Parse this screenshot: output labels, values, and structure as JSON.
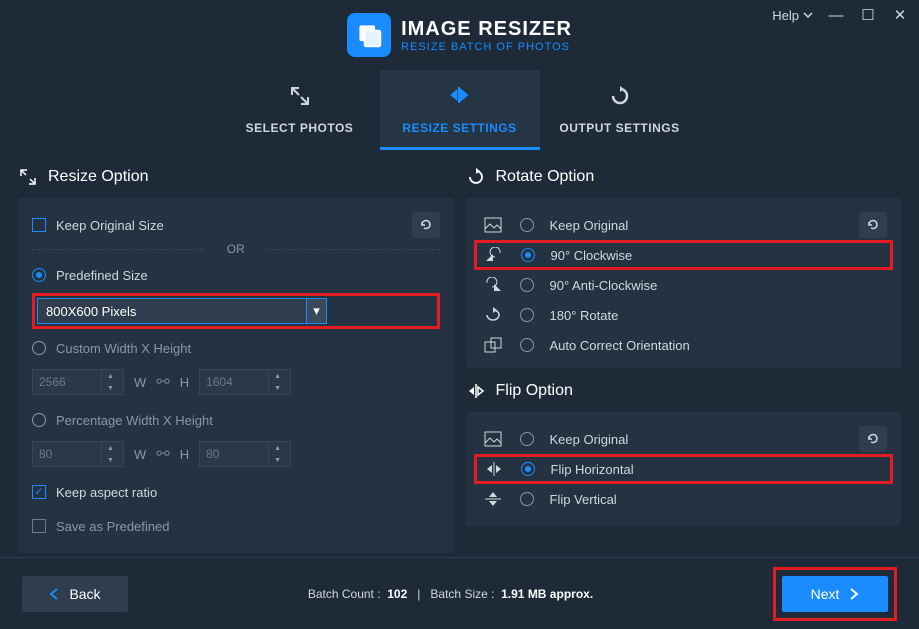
{
  "app": {
    "title": "IMAGE RESIZER",
    "subtitle": "RESIZE BATCH OF PHOTOS"
  },
  "window": {
    "help": "Help"
  },
  "tabs": {
    "select": "SELECT PHOTOS",
    "resize": "RESIZE SETTINGS",
    "output": "OUTPUT SETTINGS"
  },
  "resize": {
    "header": "Resize Option",
    "keep_original": "Keep Original Size",
    "or": "OR",
    "predefined": "Predefined Size",
    "predefined_value": "800X600 Pixels",
    "custom": "Custom Width X Height",
    "custom_w": "2566",
    "custom_h": "1604",
    "percent": "Percentage Width X Height",
    "percent_w": "80",
    "percent_h": "80",
    "w": "W",
    "h": "H",
    "keep_aspect": "Keep aspect ratio",
    "save_predef": "Save as Predefined"
  },
  "rotate": {
    "header": "Rotate Option",
    "keep": "Keep Original",
    "cw": "90° Clockwise",
    "acw": "90° Anti-Clockwise",
    "r180": "180° Rotate",
    "auto": "Auto Correct Orientation"
  },
  "flip": {
    "header": "Flip Option",
    "keep": "Keep Original",
    "horiz": "Flip Horizontal",
    "vert": "Flip Vertical"
  },
  "footer": {
    "back": "Back",
    "next": "Next",
    "batch_count_label": "Batch Count :",
    "batch_count": "102",
    "batch_size_label": "Batch Size :",
    "batch_size": "1.91 MB approx.",
    "sep": "|"
  }
}
